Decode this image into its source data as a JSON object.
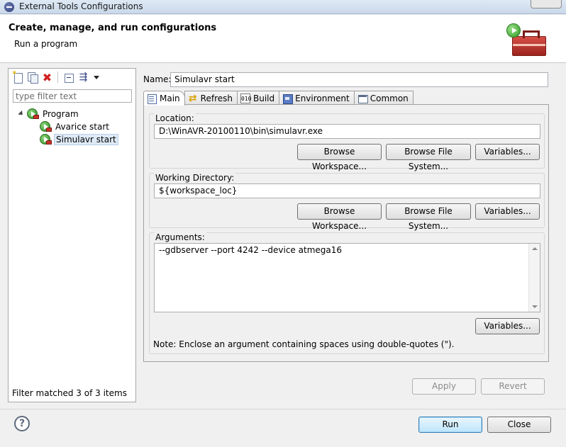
{
  "window": {
    "title": "External Tools Configurations"
  },
  "header": {
    "title": "Create, manage, and run configurations",
    "subtitle": "Run a program"
  },
  "left_panel": {
    "filter_placeholder": "type filter text",
    "tree": {
      "root": {
        "label": "Program"
      },
      "children": [
        {
          "label": "Avarice start",
          "selected": false
        },
        {
          "label": "Simulavr start",
          "selected": true
        }
      ]
    },
    "status": "Filter matched 3 of 3 items"
  },
  "config": {
    "name_label": "Name:",
    "name_value": "Simulavr start",
    "tabs": [
      {
        "label": "Main",
        "icon": "main-tab-icon",
        "active": true
      },
      {
        "label": "Refresh",
        "icon": "refresh-icon",
        "active": false
      },
      {
        "label": "Build",
        "icon": "build-icon",
        "active": false
      },
      {
        "label": "Environment",
        "icon": "environment-icon",
        "active": false
      },
      {
        "label": "Common",
        "icon": "common-icon",
        "active": false
      }
    ],
    "location": {
      "label": "Location:",
      "value": "D:\\WinAVR-20100110\\bin\\simulavr.exe",
      "browse_workspace": "Browse Workspace...",
      "browse_file_system": "Browse File System...",
      "variables": "Variables..."
    },
    "working_directory": {
      "label": "Working Directory:",
      "value": "${workspace_loc}",
      "browse_workspace": "Browse Workspace...",
      "browse_file_system": "Browse File System...",
      "variables": "Variables..."
    },
    "arguments": {
      "label": "Arguments:",
      "value": "--gdbserver --port 4242 --device atmega16",
      "variables": "Variables...",
      "note": "Note: Enclose an argument containing spaces using double-quotes (\")."
    },
    "apply": "Apply",
    "revert": "Revert"
  },
  "footer": {
    "run": "Run",
    "close": "Close"
  }
}
